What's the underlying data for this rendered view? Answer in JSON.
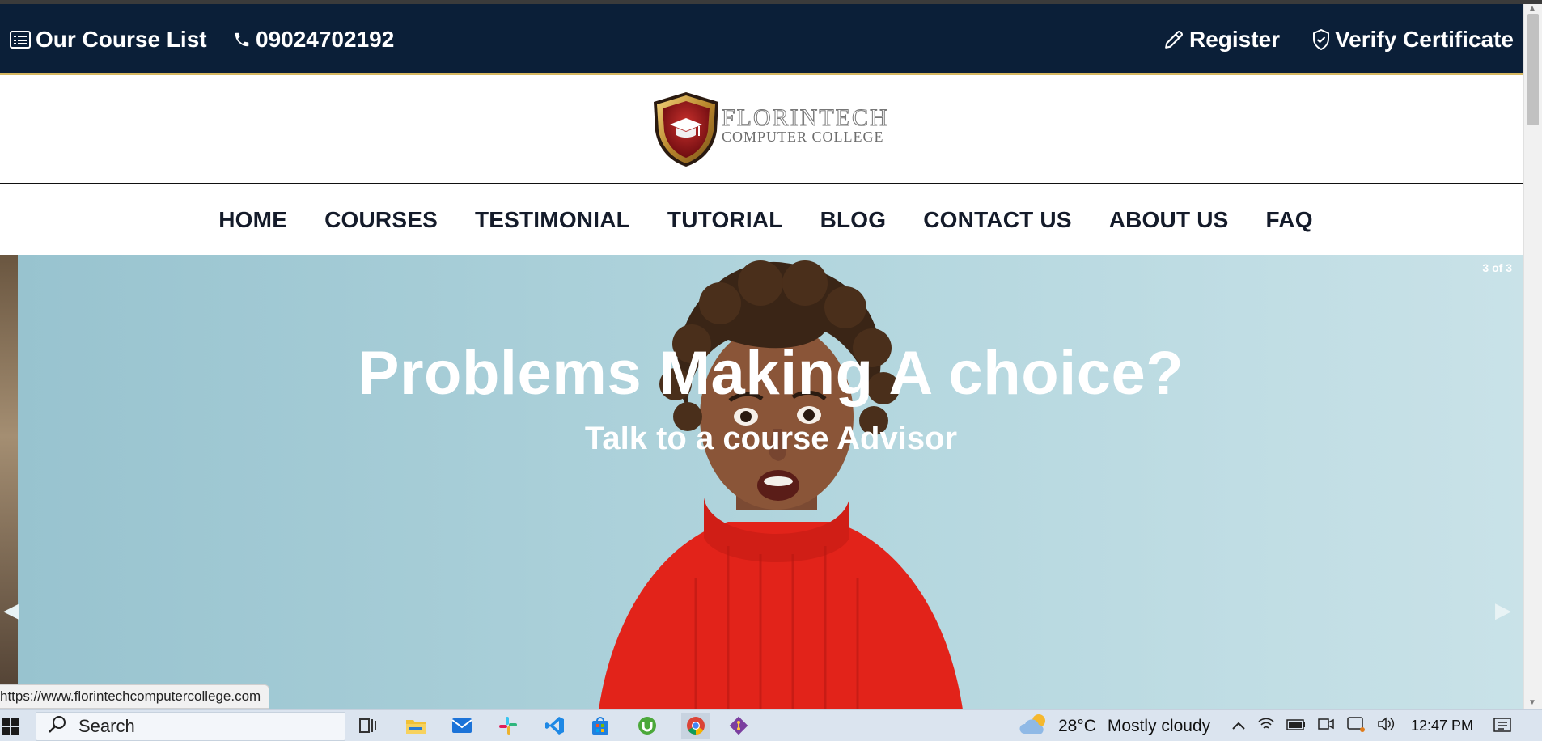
{
  "topbar": {
    "course_list": "Our Course List",
    "phone": "09024702192",
    "register": "Register",
    "verify": "Verify Certificate"
  },
  "logo": {
    "line1": "FLORINTECH",
    "line2": "COMPUTER COLLEGE"
  },
  "nav": {
    "items": [
      "HOME",
      "COURSES",
      "TESTIMONIAL",
      "TUTORIAL",
      "BLOG",
      "CONTACT US",
      "ABOUT US",
      "FAQ"
    ]
  },
  "hero": {
    "counter": "3 of 3",
    "title": "Problems Making A choice?",
    "subtitle": "Talk to a course Advisor"
  },
  "status_url": "https://www.florintechcomputercollege.com",
  "taskbar": {
    "search": "Search",
    "weather_temp": "28°C",
    "weather_desc": "Mostly cloudy",
    "time": "12:47 PM"
  },
  "colors": {
    "topbar_bg": "#0b1f38",
    "topbar_border": "#d6b760",
    "hero_bg": "#abd3dd",
    "sweater": "#e2231a"
  }
}
